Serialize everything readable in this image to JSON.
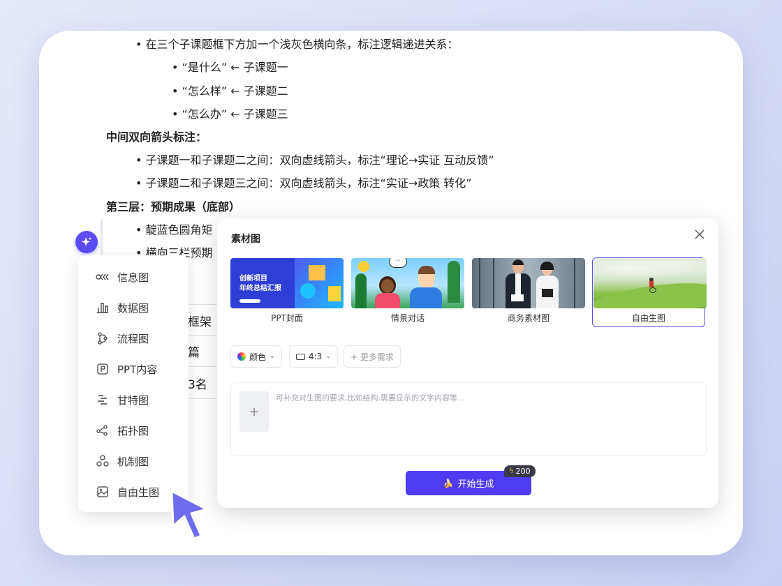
{
  "document": {
    "lines": [
      "• 在三个子课题框下方加一个浅灰色横向条，标注逻辑递进关系：",
      "• “是什么” ← 子课题一",
      "• “怎么样” ← 子课题二",
      "• “怎么办” ← 子课题三",
      "中间双向箭头标注：",
      "• 子课题一和子课题二之间：双向虚线箭头，标注“理论→实证 互动反馈”",
      "• 子课题二和子课题三之间：双向虚线箭头，标注“实证→政策 转化”",
      "第三层：预期成果（底部）",
      "• 靛蓝色圆角矩",
      "• 横向三栏预期"
    ],
    "table_cells": [
      "框架",
      "篇",
      "3名"
    ]
  },
  "menu": {
    "items": [
      {
        "label": "信息图",
        "icon": "infographic-icon"
      },
      {
        "label": "数据图",
        "icon": "bar-chart-icon"
      },
      {
        "label": "流程图",
        "icon": "flowchart-icon"
      },
      {
        "label": "PPT内容",
        "icon": "ppt-icon"
      },
      {
        "label": "甘特图",
        "icon": "gantt-icon"
      },
      {
        "label": "拓扑图",
        "icon": "topology-icon"
      },
      {
        "label": "机制图",
        "icon": "mechanism-icon"
      },
      {
        "label": "自由生图",
        "icon": "image-icon"
      }
    ]
  },
  "dialog": {
    "title": "素材图",
    "templates": [
      {
        "label": "PPT封面",
        "thumb_title": "创新项目",
        "thumb_subtitle": "年终总结汇报"
      },
      {
        "label": "情景对话"
      },
      {
        "label": "商务素材图"
      },
      {
        "label": "自由生图",
        "selected": true
      }
    ],
    "options": {
      "color": "颜色",
      "ratio": "4:3",
      "more": "+ 更多需求"
    },
    "placeholder": "可补充对生图的要求,比如结构,需要显示的文字内容等...",
    "upload_label": "+",
    "generate": "开始生成",
    "cost": "200"
  },
  "colors": {
    "accent": "#5b4cf5",
    "button": "#4f3cf2"
  }
}
